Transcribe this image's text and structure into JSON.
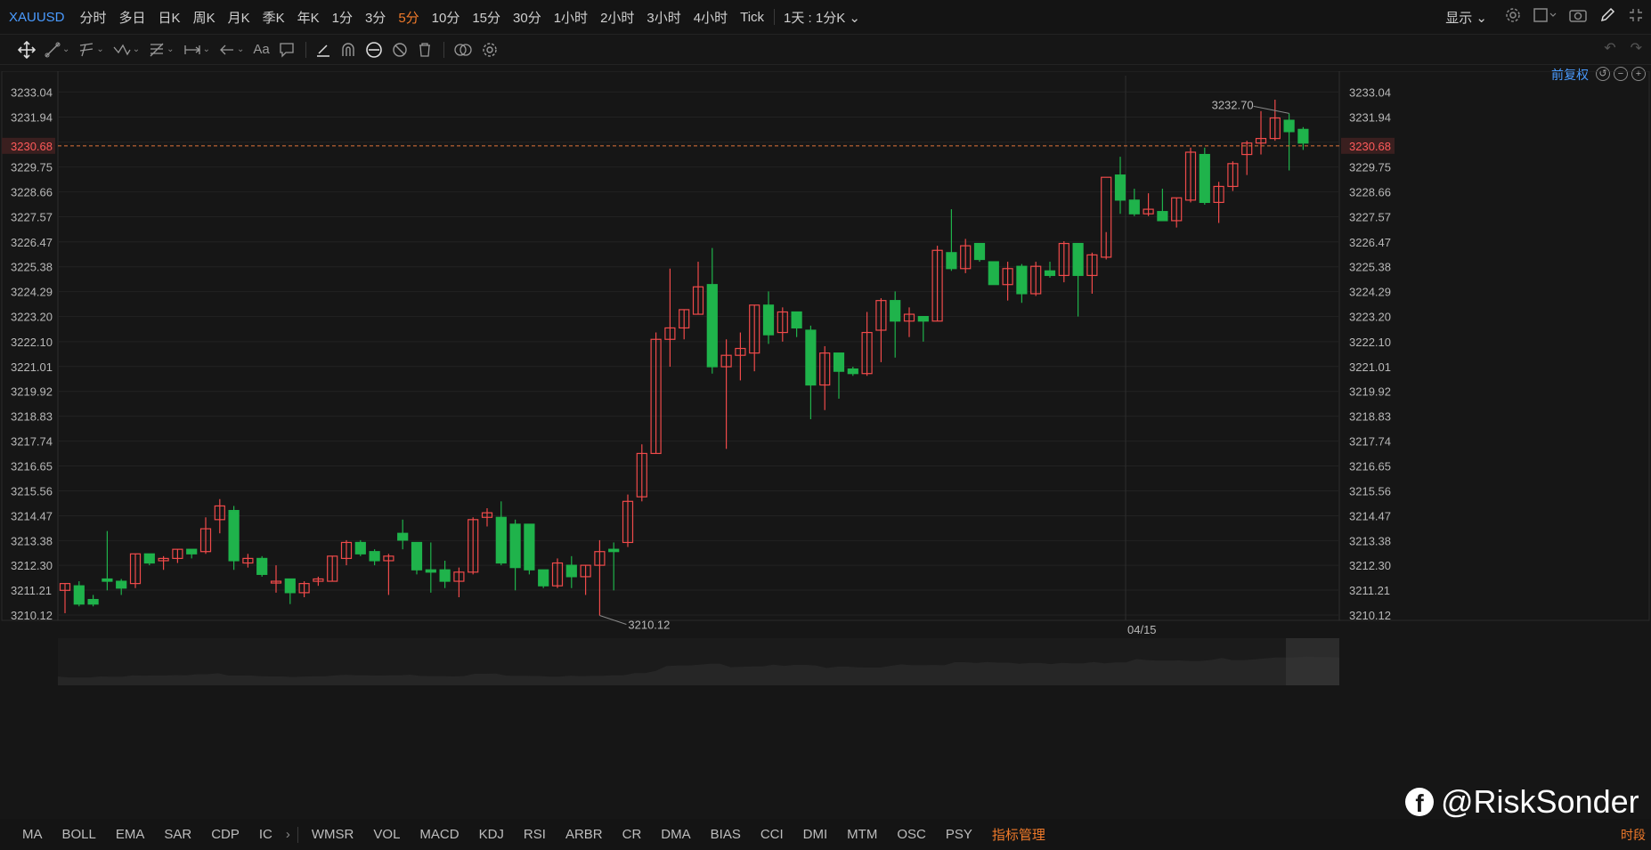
{
  "toolbar": {
    "symbol": "XAUUSD",
    "periods": [
      "分时",
      "多日",
      "日K",
      "周K",
      "月K",
      "季K",
      "年K",
      "1分",
      "3分",
      "5分",
      "10分",
      "15分",
      "30分",
      "1小时",
      "2小时",
      "3小时",
      "4小时",
      "Tick"
    ],
    "active_period": "5分",
    "range_select": "1天 : 1分K",
    "display_label": "显示"
  },
  "adjust_label": "前复权",
  "indicators": [
    "MA",
    "BOLL",
    "EMA",
    "SAR",
    "CDP",
    "IC",
    "WMSR",
    "VOL",
    "MACD",
    "KDJ",
    "RSI",
    "ARBR",
    "CR",
    "DMA",
    "BIAS",
    "CCI",
    "DMI",
    "MTM",
    "OSC",
    "PSY"
  ],
  "indicator_manage": "指标管理",
  "segment_label": "时段",
  "watermark": "@RiskSonder",
  "colors": {
    "up": "#ef4a4a",
    "down": "#1fb34b",
    "price_line": "#e0733a",
    "accent": "#f07a2a",
    "link": "#4a9bff"
  },
  "chart_data": {
    "type": "candlestick",
    "ylim": [
      3209.3,
      3233.9
    ],
    "y_ticks": [
      "3233.04",
      "3231.94",
      "3230.84",
      "3229.75",
      "3228.66",
      "3227.57",
      "3226.47",
      "3225.38",
      "3224.29",
      "3223.20",
      "3222.10",
      "3221.01",
      "3219.92",
      "3218.83",
      "3217.74",
      "3216.65",
      "3215.56",
      "3214.47",
      "3213.38",
      "3212.30",
      "3211.21",
      "3210.12"
    ],
    "current_price": "3230.68",
    "max_label": "3232.70",
    "min_label": "3210.12",
    "date_label": "04/15",
    "date_label_index": 75,
    "max_index": 87,
    "min_index": 38,
    "candles": [
      {
        "o": 3211.2,
        "h": 3211.5,
        "l": 3210.2,
        "c": 3211.5
      },
      {
        "o": 3211.4,
        "h": 3211.6,
        "l": 3210.5,
        "c": 3210.6
      },
      {
        "o": 3210.8,
        "h": 3211.0,
        "l": 3210.5,
        "c": 3210.6
      },
      {
        "o": 3211.7,
        "h": 3213.8,
        "l": 3211.2,
        "c": 3211.6
      },
      {
        "o": 3211.6,
        "h": 3211.7,
        "l": 3211.0,
        "c": 3211.3
      },
      {
        "o": 3211.5,
        "h": 3212.8,
        "l": 3211.3,
        "c": 3212.8
      },
      {
        "o": 3212.8,
        "h": 3212.8,
        "l": 3212.3,
        "c": 3212.4
      },
      {
        "o": 3212.5,
        "h": 3212.7,
        "l": 3212.1,
        "c": 3212.6
      },
      {
        "o": 3212.6,
        "h": 3213.0,
        "l": 3212.4,
        "c": 3213.0
      },
      {
        "o": 3213.0,
        "h": 3213.0,
        "l": 3212.6,
        "c": 3212.8
      },
      {
        "o": 3212.9,
        "h": 3214.4,
        "l": 3212.8,
        "c": 3213.9
      },
      {
        "o": 3214.3,
        "h": 3215.2,
        "l": 3213.7,
        "c": 3214.9
      },
      {
        "o": 3214.7,
        "h": 3214.9,
        "l": 3212.1,
        "c": 3212.5
      },
      {
        "o": 3212.4,
        "h": 3212.8,
        "l": 3212.2,
        "c": 3212.6
      },
      {
        "o": 3212.6,
        "h": 3212.7,
        "l": 3211.8,
        "c": 3211.9
      },
      {
        "o": 3211.6,
        "h": 3212.3,
        "l": 3211.1,
        "c": 3211.6
      },
      {
        "o": 3211.7,
        "h": 3211.7,
        "l": 3210.6,
        "c": 3211.1
      },
      {
        "o": 3211.1,
        "h": 3211.6,
        "l": 3210.9,
        "c": 3211.5
      },
      {
        "o": 3211.6,
        "h": 3211.8,
        "l": 3211.4,
        "c": 3211.7
      },
      {
        "o": 3211.6,
        "h": 3212.7,
        "l": 3211.6,
        "c": 3212.7
      },
      {
        "o": 3212.6,
        "h": 3213.4,
        "l": 3212.3,
        "c": 3213.3
      },
      {
        "o": 3213.3,
        "h": 3213.4,
        "l": 3212.7,
        "c": 3212.8
      },
      {
        "o": 3212.9,
        "h": 3213.0,
        "l": 3212.3,
        "c": 3212.5
      },
      {
        "o": 3212.5,
        "h": 3212.8,
        "l": 3211.0,
        "c": 3212.7
      },
      {
        "o": 3213.7,
        "h": 3214.3,
        "l": 3213.0,
        "c": 3213.4
      },
      {
        "o": 3213.3,
        "h": 3213.3,
        "l": 3211.9,
        "c": 3212.1
      },
      {
        "o": 3212.1,
        "h": 3213.3,
        "l": 3211.1,
        "c": 3212.0
      },
      {
        "o": 3212.1,
        "h": 3212.5,
        "l": 3211.3,
        "c": 3211.6
      },
      {
        "o": 3211.6,
        "h": 3212.2,
        "l": 3210.9,
        "c": 3212.0
      },
      {
        "o": 3212.0,
        "h": 3214.4,
        "l": 3211.9,
        "c": 3214.3
      },
      {
        "o": 3214.4,
        "h": 3214.8,
        "l": 3214.0,
        "c": 3214.6
      },
      {
        "o": 3214.4,
        "h": 3215.1,
        "l": 3212.3,
        "c": 3212.4
      },
      {
        "o": 3214.1,
        "h": 3214.3,
        "l": 3211.2,
        "c": 3212.2
      },
      {
        "o": 3214.1,
        "h": 3214.1,
        "l": 3211.9,
        "c": 3212.1
      },
      {
        "o": 3212.1,
        "h": 3212.1,
        "l": 3211.3,
        "c": 3211.4
      },
      {
        "o": 3211.4,
        "h": 3212.6,
        "l": 3211.3,
        "c": 3212.4
      },
      {
        "o": 3212.3,
        "h": 3212.7,
        "l": 3211.3,
        "c": 3211.8
      },
      {
        "o": 3211.8,
        "h": 3212.3,
        "l": 3211.0,
        "c": 3212.3
      },
      {
        "o": 3212.3,
        "h": 3213.4,
        "l": 3210.1,
        "c": 3212.9
      },
      {
        "o": 3213.0,
        "h": 3213.3,
        "l": 3211.2,
        "c": 3212.9
      },
      {
        "o": 3213.3,
        "h": 3215.4,
        "l": 3213.1,
        "c": 3215.1
      },
      {
        "o": 3215.3,
        "h": 3217.6,
        "l": 3215.1,
        "c": 3217.2
      },
      {
        "o": 3217.2,
        "h": 3222.5,
        "l": 3217.2,
        "c": 3222.2
      },
      {
        "o": 3222.2,
        "h": 3225.3,
        "l": 3221.0,
        "c": 3222.7
      },
      {
        "o": 3222.7,
        "h": 3223.5,
        "l": 3222.2,
        "c": 3223.5
      },
      {
        "o": 3223.3,
        "h": 3225.6,
        "l": 3223.3,
        "c": 3224.5
      },
      {
        "o": 3224.6,
        "h": 3226.2,
        "l": 3220.7,
        "c": 3221.0
      },
      {
        "o": 3221.0,
        "h": 3222.2,
        "l": 3217.4,
        "c": 3221.5
      },
      {
        "o": 3221.5,
        "h": 3222.5,
        "l": 3220.4,
        "c": 3221.8
      },
      {
        "o": 3221.6,
        "h": 3223.7,
        "l": 3220.8,
        "c": 3223.7
      },
      {
        "o": 3223.7,
        "h": 3224.3,
        "l": 3222.0,
        "c": 3222.4
      },
      {
        "o": 3222.5,
        "h": 3223.6,
        "l": 3222.1,
        "c": 3223.4
      },
      {
        "o": 3223.4,
        "h": 3223.4,
        "l": 3222.3,
        "c": 3222.7
      },
      {
        "o": 3222.6,
        "h": 3222.8,
        "l": 3218.7,
        "c": 3220.2
      },
      {
        "o": 3220.2,
        "h": 3221.9,
        "l": 3219.1,
        "c": 3221.6
      },
      {
        "o": 3221.6,
        "h": 3221.6,
        "l": 3219.6,
        "c": 3220.8
      },
      {
        "o": 3220.9,
        "h": 3221.0,
        "l": 3220.6,
        "c": 3220.7
      },
      {
        "o": 3220.7,
        "h": 3223.4,
        "l": 3220.6,
        "c": 3222.5
      },
      {
        "o": 3222.6,
        "h": 3224.0,
        "l": 3221.2,
        "c": 3223.9
      },
      {
        "o": 3223.9,
        "h": 3224.3,
        "l": 3221.4,
        "c": 3223.0
      },
      {
        "o": 3223.0,
        "h": 3223.6,
        "l": 3222.3,
        "c": 3223.3
      },
      {
        "o": 3223.2,
        "h": 3223.2,
        "l": 3222.1,
        "c": 3223.0
      },
      {
        "o": 3223.0,
        "h": 3226.3,
        "l": 3223.0,
        "c": 3226.1
      },
      {
        "o": 3226.0,
        "h": 3227.9,
        "l": 3225.2,
        "c": 3225.3
      },
      {
        "o": 3225.3,
        "h": 3226.6,
        "l": 3225.1,
        "c": 3226.3
      },
      {
        "o": 3226.4,
        "h": 3226.4,
        "l": 3225.6,
        "c": 3225.7
      },
      {
        "o": 3225.6,
        "h": 3225.6,
        "l": 3224.7,
        "c": 3224.6
      },
      {
        "o": 3224.6,
        "h": 3225.6,
        "l": 3223.9,
        "c": 3225.3
      },
      {
        "o": 3225.4,
        "h": 3225.5,
        "l": 3223.8,
        "c": 3224.2
      },
      {
        "o": 3224.2,
        "h": 3225.6,
        "l": 3224.1,
        "c": 3225.4
      },
      {
        "o": 3225.2,
        "h": 3225.6,
        "l": 3224.9,
        "c": 3225.0
      },
      {
        "o": 3225.0,
        "h": 3226.5,
        "l": 3224.7,
        "c": 3226.4
      },
      {
        "o": 3226.4,
        "h": 3226.4,
        "l": 3223.2,
        "c": 3225.0
      },
      {
        "o": 3225.0,
        "h": 3226.0,
        "l": 3224.2,
        "c": 3225.9
      },
      {
        "o": 3225.8,
        "h": 3226.9,
        "l": 3225.7,
        "c": 3229.3
      },
      {
        "o": 3229.4,
        "h": 3230.2,
        "l": 3227.7,
        "c": 3228.3
      },
      {
        "o": 3228.3,
        "h": 3228.8,
        "l": 3227.6,
        "c": 3227.7
      },
      {
        "o": 3227.7,
        "h": 3228.6,
        "l": 3227.6,
        "c": 3227.9
      },
      {
        "o": 3227.8,
        "h": 3228.8,
        "l": 3227.5,
        "c": 3227.4
      },
      {
        "o": 3227.4,
        "h": 3228.4,
        "l": 3227.1,
        "c": 3228.4
      },
      {
        "o": 3228.3,
        "h": 3230.6,
        "l": 3228.2,
        "c": 3230.4
      },
      {
        "o": 3230.3,
        "h": 3230.6,
        "l": 3228.1,
        "c": 3228.2
      },
      {
        "o": 3228.2,
        "h": 3229.1,
        "l": 3227.3,
        "c": 3228.9
      },
      {
        "o": 3228.9,
        "h": 3230.0,
        "l": 3228.7,
        "c": 3229.9
      },
      {
        "o": 3230.3,
        "h": 3230.9,
        "l": 3229.4,
        "c": 3230.8
      },
      {
        "o": 3230.8,
        "h": 3232.2,
        "l": 3230.3,
        "c": 3231.0
      },
      {
        "o": 3231.0,
        "h": 3232.7,
        "l": 3230.9,
        "c": 3231.9
      },
      {
        "o": 3231.8,
        "h": 3232.1,
        "l": 3229.6,
        "c": 3231.3
      },
      {
        "o": 3231.4,
        "h": 3231.5,
        "l": 3230.5,
        "c": 3230.8
      }
    ]
  }
}
